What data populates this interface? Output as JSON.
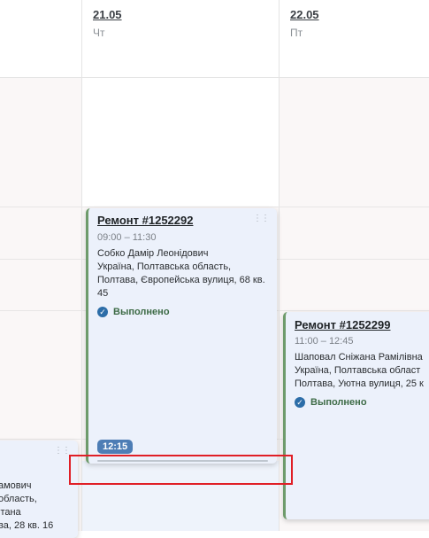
{
  "columns": [
    {
      "date": "21.05",
      "day": "Чт"
    },
    {
      "date": "22.05",
      "day": "Пт"
    }
  ],
  "cards": [
    {
      "title": "Ремонт #1252292",
      "time": "09:00 – 11:30",
      "name": "Собко Дамір Леонідович",
      "address": "Україна, Полтавська область, Полтава, Європейська вулиця, 68 кв. 45",
      "status": "Выполнено",
      "drag_time": "12:15"
    },
    {
      "title": "Ремонт #1252299",
      "time": "11:00 – 12:45",
      "name": "Шаповал Сніжана Рамілівна",
      "address": "Україна, Полтавська област Полтава, Уютна вулиця, 25 к",
      "status": "Выполнено"
    },
    {
      "partial_lines": [
        "амович",
        "область,",
        "ітана",
        "ва, 28 кв. 16"
      ]
    }
  ],
  "colors": {
    "card_border": "#6e9b6b",
    "badge": "#4d7db5",
    "status_icon": "#2c6da8",
    "highlight": "#e01f26"
  },
  "icons": {
    "status": "check-circle-icon",
    "drag": "drag-dots-icon"
  }
}
